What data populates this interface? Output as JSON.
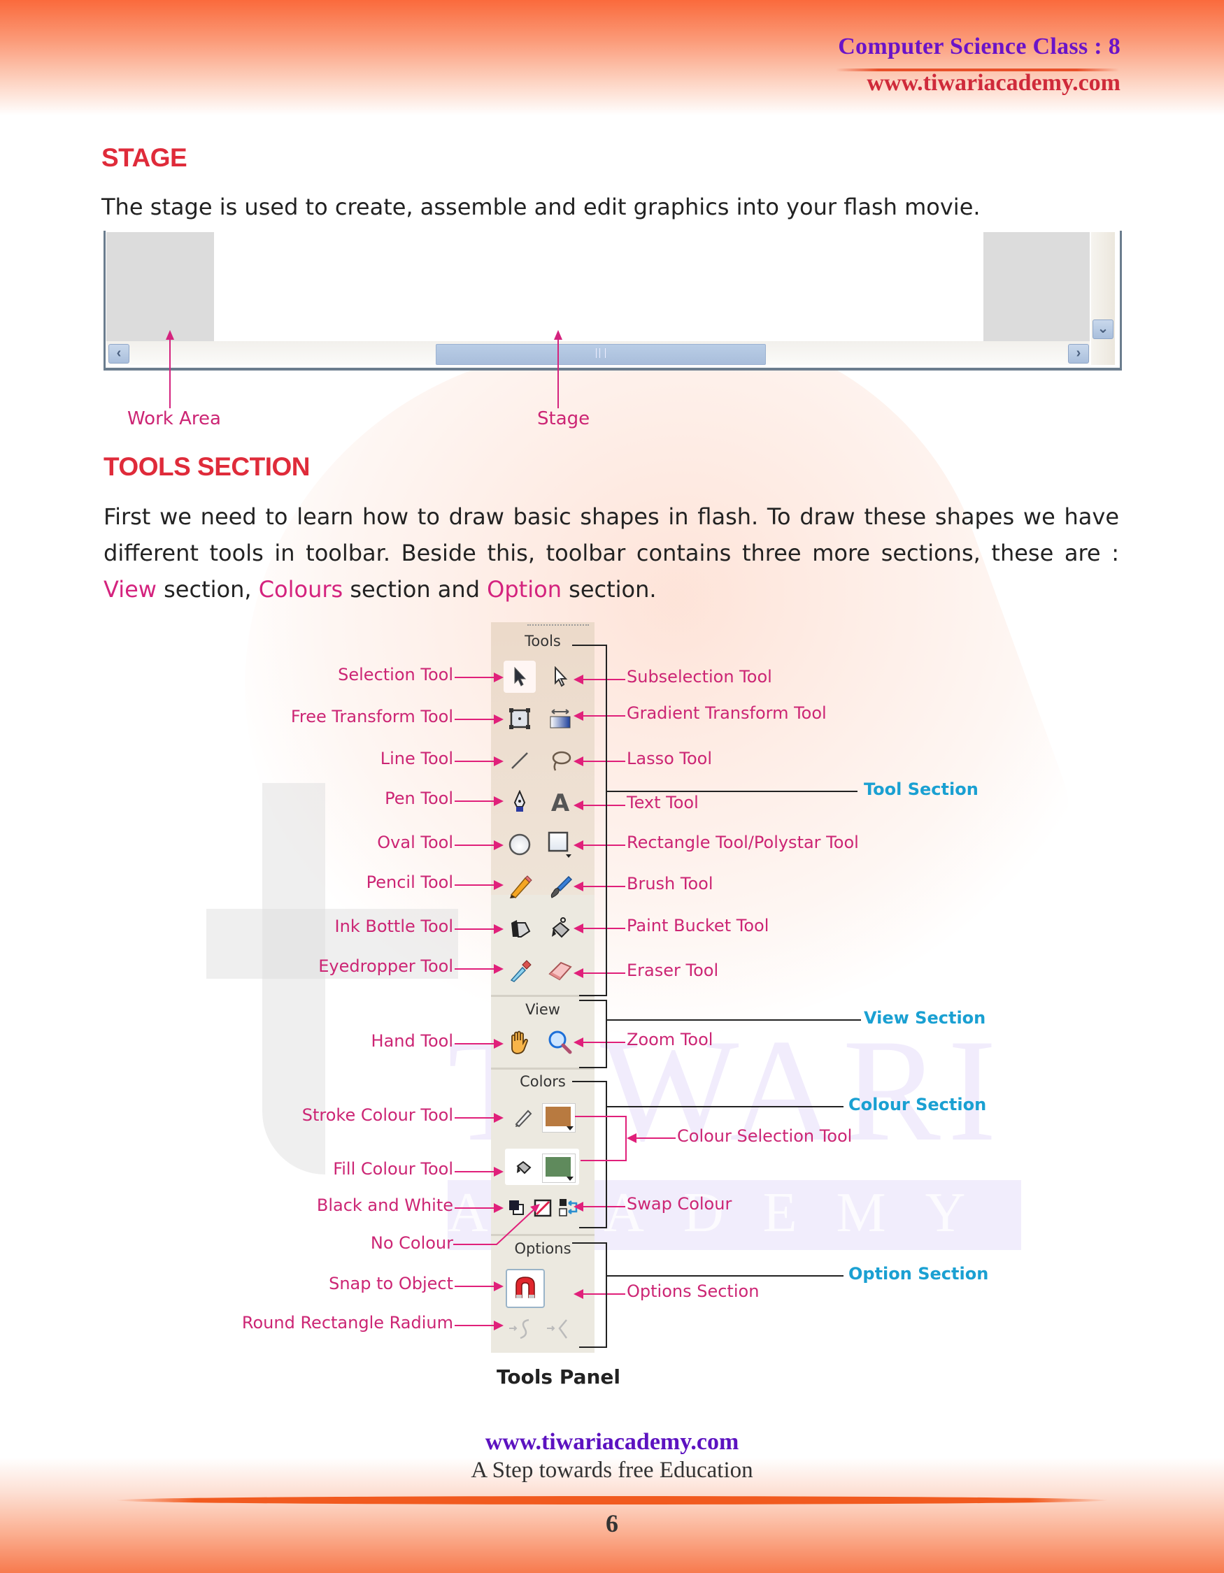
{
  "header": {
    "title": "Computer Science Class : 8",
    "url": "www.tiwariacademy.com"
  },
  "watermark": {
    "word1": "TIWARI",
    "word2": "ACADEMY"
  },
  "stage_section": {
    "heading": "STAGE",
    "description": "The stage is used to create, assemble and edit graphics into your flash movie.",
    "figure": {
      "scroll_left_glyph": "‹",
      "scroll_right_glyph": "›",
      "scroll_down_glyph": "⌄",
      "labels": {
        "work_area": "Work Area",
        "stage": "Stage"
      }
    }
  },
  "tools_section": {
    "heading": "TOOLS SECTION",
    "paragraph": {
      "part1": "First we need to learn how to draw basic  shapes  in flash.  To  draw these shapes we have different tools in toolbar. Beside this, toolbar contains three more sections, these are : ",
      "view": "View",
      "part2": " section, ",
      "colours": "Colours",
      "part3": " section and ",
      "option": "Option",
      "part4": " section."
    }
  },
  "tools_panel": {
    "caption": "Tools Panel",
    "group_titles": {
      "tools": "Tools",
      "view": "View",
      "colors": "Colors",
      "options": "Options"
    },
    "left_labels": [
      "Selection Tool",
      "Free Transform Tool",
      "Line Tool",
      "Pen Tool",
      "Oval Tool",
      "Pencil Tool",
      "Ink Bottle Tool",
      "Eyedropper Tool",
      "Hand Tool",
      "Stroke Colour Tool",
      "Fill Colour Tool",
      "Black and White",
      "No Colour",
      "Snap to Object",
      "Round Rectangle Radium"
    ],
    "right_labels": [
      "Subselection Tool",
      "Gradient Transform Tool",
      "Lasso Tool",
      "Text Tool",
      "Rectangle Tool/Polystar Tool",
      "Brush Tool",
      "Paint Bucket Tool",
      "Eraser Tool",
      "Zoom Tool",
      "Colour Selection Tool",
      "Swap Colour",
      "Options Section"
    ],
    "section_labels": {
      "tool": "Tool Section",
      "view": "View Section",
      "colour": "Colour Section",
      "option": "Option Section"
    },
    "colors": {
      "stroke": "#b87a40",
      "fill": "#5f8a5c",
      "label": "#cc2574",
      "section_label": "#1aa0d2"
    }
  },
  "footer": {
    "url": "www.tiwariacademy.com",
    "tagline": "A Step towards free Education",
    "page_number": "6"
  }
}
